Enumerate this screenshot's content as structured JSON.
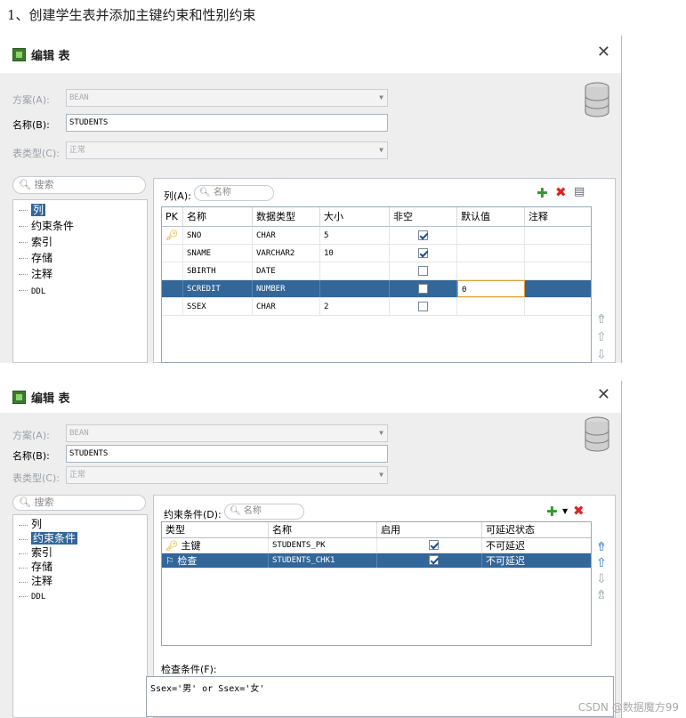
{
  "heading": "1、创建学生表并添加主键约束和性别约束",
  "dialog1": {
    "title": "编辑 表",
    "scheme_label": "方案(A):",
    "scheme_value": "BEAN",
    "name_label": "名称(B):",
    "name_value": "STUDENTS",
    "type_label": "表类型(C):",
    "type_value": "正常",
    "search_placeholder": "搜索",
    "tree": [
      "列",
      "约束条件",
      "索引",
      "存储",
      "注释",
      "DDL"
    ],
    "selected_tree": "列",
    "grid_label": "列(A):",
    "grid_search": "名称",
    "columns": [
      "PK",
      "名称",
      "数据类型",
      "大小",
      "非空",
      "默认值",
      "注释"
    ],
    "rows": [
      {
        "pk": true,
        "name": "SNO",
        "type": "CHAR",
        "size": "5",
        "notnull": true,
        "default": "",
        "comment": ""
      },
      {
        "pk": false,
        "name": "SNAME",
        "type": "VARCHAR2",
        "size": "10",
        "notnull": true,
        "default": "",
        "comment": ""
      },
      {
        "pk": false,
        "name": "SBIRTH",
        "type": "DATE",
        "size": "",
        "notnull": false,
        "default": "",
        "comment": ""
      },
      {
        "pk": false,
        "name": "SCREDIT",
        "type": "NUMBER",
        "size": "",
        "notnull": false,
        "default": "0",
        "comment": "",
        "selected": true
      },
      {
        "pk": false,
        "name": "SSEX",
        "type": "CHAR",
        "size": "2",
        "notnull": false,
        "default": "",
        "comment": ""
      }
    ]
  },
  "dialog2": {
    "title": "编辑 表",
    "scheme_label": "方案(A):",
    "scheme_value": "BEAN",
    "name_label": "名称(B):",
    "name_value": "STUDENTS",
    "type_label": "表类型(C):",
    "type_value": "正常",
    "search_placeholder": "搜索",
    "tree": [
      "列",
      "约束条件",
      "索引",
      "存储",
      "注释",
      "DDL"
    ],
    "selected_tree": "约束条件",
    "grid_label": "约束条件(D):",
    "grid_search": "名称",
    "columns": [
      "类型",
      "名称",
      "启用",
      "可延迟状态"
    ],
    "rows": [
      {
        "type": "主键",
        "name": "STUDENTS_PK",
        "enabled": true,
        "deferrable": "不可延迟"
      },
      {
        "type": "检查",
        "name": "STUDENTS_CHK1",
        "enabled": true,
        "deferrable": "不可延迟",
        "selected": true
      }
    ],
    "check_label": "检查条件(F):",
    "check_value": "Ssex='男' or Ssex='女'"
  },
  "watermark": "CSDN @数据魔方99"
}
